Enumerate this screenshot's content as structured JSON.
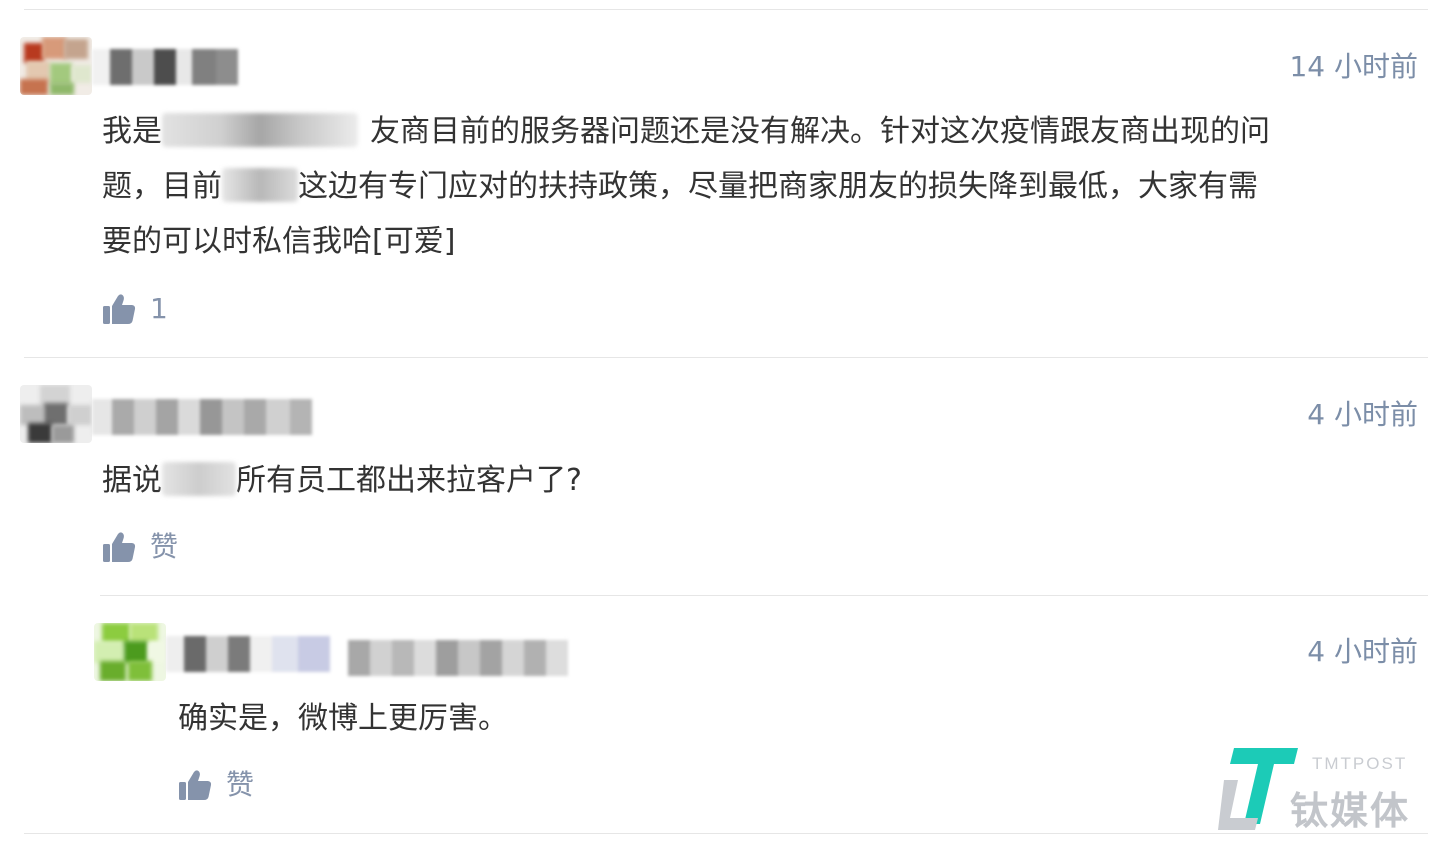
{
  "comments": [
    {
      "time": "14 小时前",
      "text_parts": [
        "我是",
        "友商目前的服务器问题还是没有解决。针对这次疫情跟友商出现的问",
        "题，目前",
        "这边有专门应对的扶持政策，尽量把商家朋友的损失降到最低，大家有需",
        "要的可以时私信我哈[可爱]"
      ],
      "like_label": "1"
    },
    {
      "time": "4 小时前",
      "text_parts": [
        "据说",
        "所有员工都出来拉客户了?"
      ],
      "like_label": "赞"
    }
  ],
  "reply": {
    "time": "4 小时前",
    "text": "确实是，微博上更厉害。",
    "like_label": "赞"
  },
  "icons": {
    "like": "thumbs-up-icon"
  },
  "watermark": {
    "en": "TMTPOST",
    "zh": "钛媒体",
    "accent": "#1ccbb7"
  },
  "colors": {
    "time": "#7c8ea8",
    "like": "#8593ab",
    "text": "#333333",
    "divider": "#e6e6e6"
  }
}
